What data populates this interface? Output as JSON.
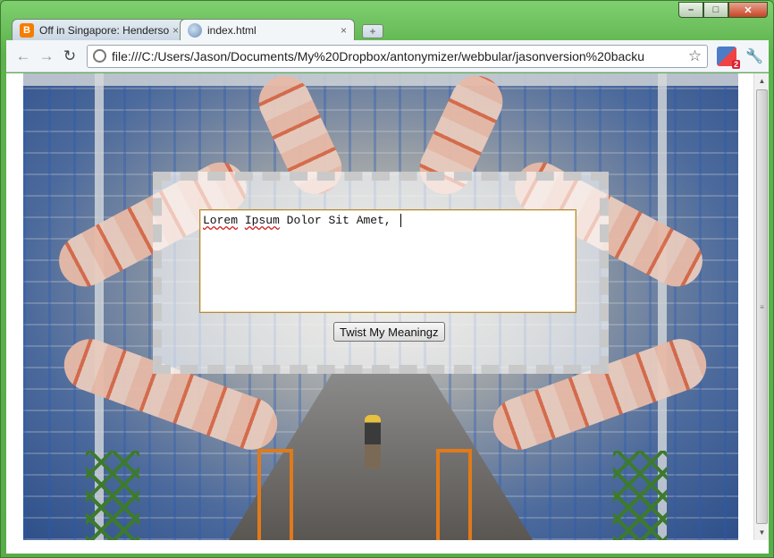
{
  "window": {
    "minimize_glyph": "–",
    "maximize_glyph": "□",
    "close_glyph": "✕"
  },
  "tabs": [
    {
      "title": "Off in Singapore: Henderson",
      "favicon": "blogger-icon",
      "close": "×"
    },
    {
      "title": "index.html",
      "favicon": "globe-icon",
      "close": "×",
      "active": true
    }
  ],
  "newtab_glyph": "+",
  "toolbar": {
    "back_glyph": "←",
    "forward_glyph": "→",
    "reload_glyph": "↻",
    "url": "file:///C:/Users/Jason/Documents/My%20Dropbox/antonymizer/webbular/jasonversion%20backu",
    "star_glyph": "☆",
    "extension_badge": "2",
    "wrench_glyph": "🔧"
  },
  "page": {
    "textarea_words": [
      "Lorem",
      "Ipsum",
      "Dolor",
      "Sit",
      "Amet,"
    ],
    "button_label": "Twist My Meaningz"
  },
  "scrollbar": {
    "up_glyph": "▲",
    "down_glyph": "▼",
    "grip_glyph": "≡"
  },
  "colors": {
    "frame": "#5fb650",
    "close_button": "#c54427",
    "textarea_border": "#b28b3e",
    "panel_dash": "#c8c8c8"
  }
}
